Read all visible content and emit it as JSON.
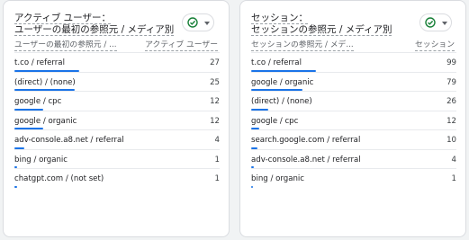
{
  "cards": [
    {
      "title_line1": "アクティブ ユーザー：",
      "title_line2": "ユーザーの最初の参照元 / メディア別",
      "dimension_header": "ユーザーの最初の参照元 / ...",
      "metric_header": "アクティブ ユーザー",
      "chip_icons": [
        "check-circle-icon",
        "caret-down-icon"
      ],
      "rows": [
        {
          "label": "t.co / referral",
          "value": "27",
          "fraction": 1.0
        },
        {
          "label": "(direct) / (none)",
          "value": "25",
          "fraction": 0.926
        },
        {
          "label": "google / cpc",
          "value": "12",
          "fraction": 0.444
        },
        {
          "label": "google / organic",
          "value": "12",
          "fraction": 0.444
        },
        {
          "label": "adv-console.a8.net / referral",
          "value": "4",
          "fraction": 0.148
        },
        {
          "label": "bing / organic",
          "value": "1",
          "fraction": 0.037
        },
        {
          "label": "chatgpt.com / (not set)",
          "value": "1",
          "fraction": 0.037
        }
      ]
    },
    {
      "title_line1": "セッション：",
      "title_line2": "セッションの参照元 / メディア別",
      "dimension_header": "セッションの参照元 / メデ...",
      "metric_header": "セッション",
      "chip_icons": [
        "check-circle-icon",
        "caret-down-icon"
      ],
      "rows": [
        {
          "label": "t.co / referral",
          "value": "99",
          "fraction": 1.0
        },
        {
          "label": "google / organic",
          "value": "79",
          "fraction": 0.798
        },
        {
          "label": "(direct) / (none)",
          "value": "26",
          "fraction": 0.263
        },
        {
          "label": "google / cpc",
          "value": "12",
          "fraction": 0.121
        },
        {
          "label": "search.google.com / referral",
          "value": "10",
          "fraction": 0.101
        },
        {
          "label": "adv-console.a8.net / referral",
          "value": "4",
          "fraction": 0.04
        },
        {
          "label": "bing / organic",
          "value": "1",
          "fraction": 0.01
        }
      ]
    }
  ],
  "colors": {
    "bar": "#1a73e8",
    "check": "#188038"
  }
}
